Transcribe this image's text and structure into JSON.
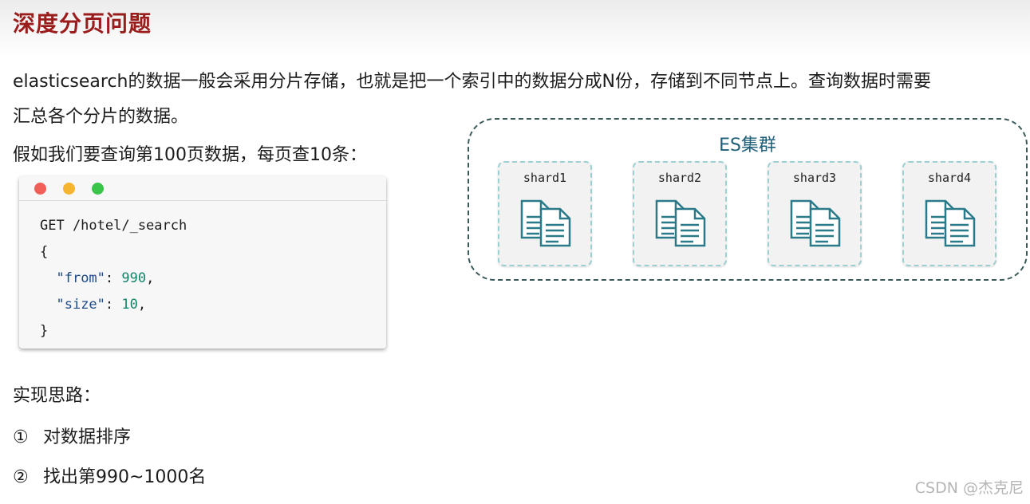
{
  "title": "深度分页问题",
  "intro_line1": "elasticsearch的数据一般会采用分片存储，也就是把一个索引中的数据分成N份，存储到不同节点上。查询数据时需要",
  "intro_line2": "汇总各个分片的数据。",
  "query_intro": "假如我们要查询第100页数据，每页查10条：",
  "code": {
    "request": "GET /hotel/_search",
    "open_brace": "{",
    "from_key": "\"from\"",
    "from_value": "990",
    "size_key": "\"size\"",
    "size_value": "10",
    "close_brace": "}"
  },
  "cluster": {
    "title": "ES集群",
    "shards": [
      "shard1",
      "shard2",
      "shard3",
      "shard4"
    ]
  },
  "approach_title": "实现思路：",
  "steps": [
    {
      "num": "①",
      "text": "对数据排序"
    },
    {
      "num": "②",
      "text": "找出第990~1000名"
    }
  ],
  "watermark": "CSDN @杰克尼",
  "colors": {
    "title": "#9b1c1c",
    "cluster_title": "#1f5f7a",
    "icon": "#2a7a8a"
  },
  "icons": [
    "document-copy-icon"
  ]
}
